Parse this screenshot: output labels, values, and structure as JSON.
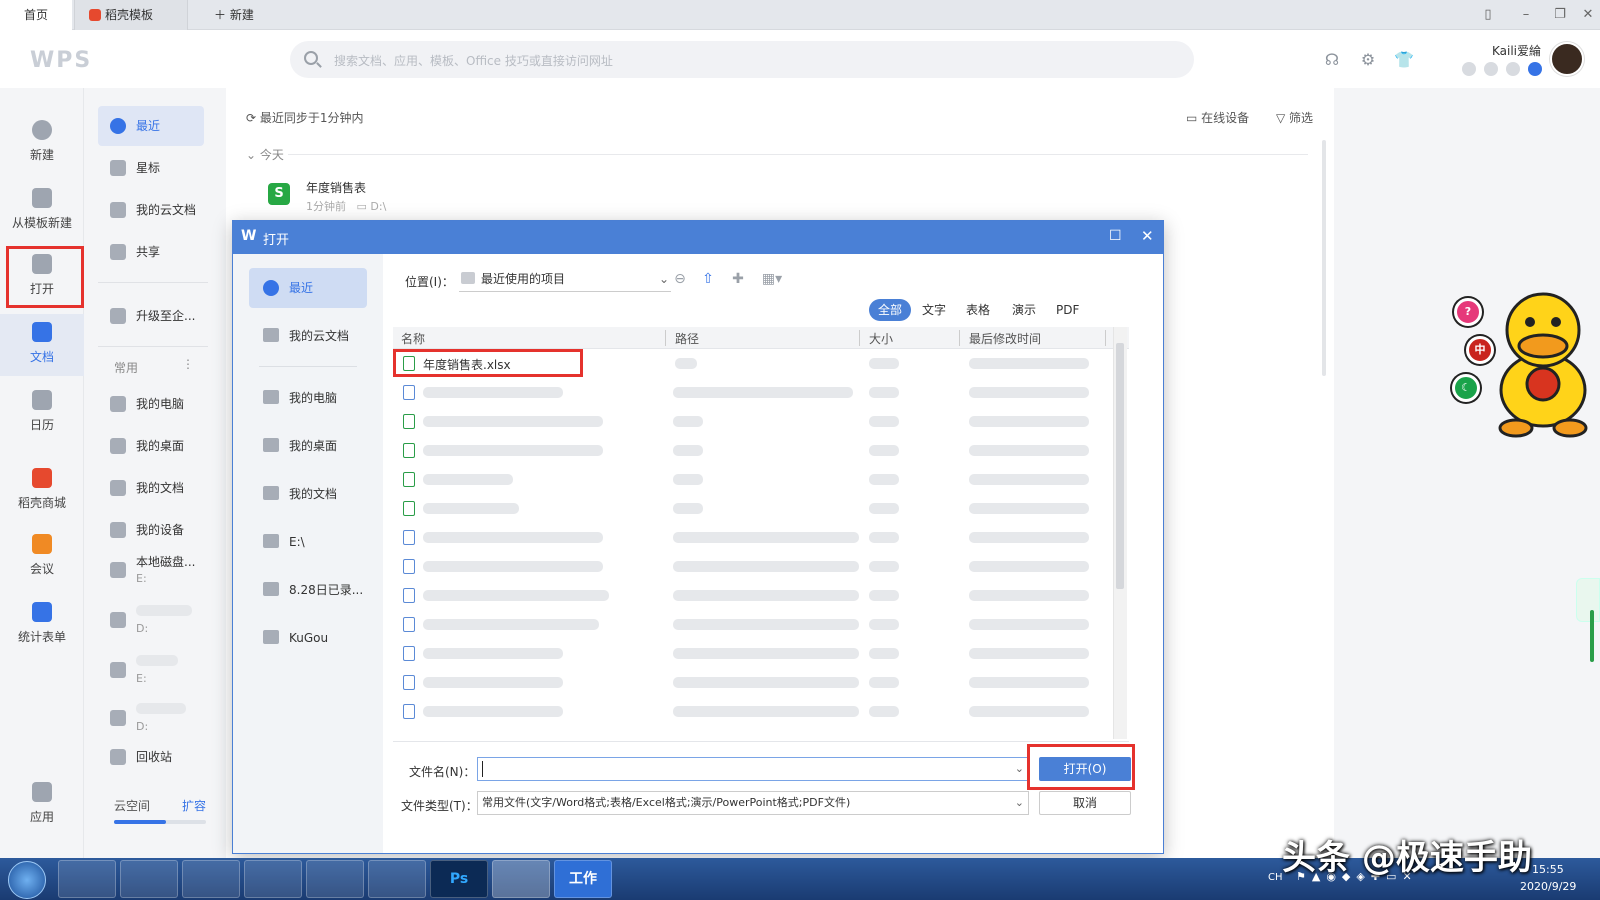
{
  "tabs": {
    "home": "首页",
    "templates": "稻壳模板",
    "new": "新建"
  },
  "header": {
    "logo": "WPS",
    "search_placeholder": "搜索文档、应用、模板、Office 技巧或直接访问网址",
    "user_name": "Kaili爱綸"
  },
  "rail": {
    "new": "新建",
    "from_template": "从模板新建",
    "open": "打开",
    "docs": "文档",
    "calendar": "日历",
    "store": "稻壳商城",
    "meeting": "会议",
    "forms": "统计表单",
    "apps": "应用"
  },
  "nav": {
    "recent": "最近",
    "starred": "星标",
    "cloud_docs": "我的云文档",
    "shared": "共享",
    "upgrade": "升级至企...",
    "common": "常用",
    "my_computer": "我的电脑",
    "my_desktop": "我的桌面",
    "my_docs": "我的文档",
    "my_devices": "我的设备",
    "local_disk": "本地磁盘...",
    "local_disk_sub": "E:",
    "item_d_sub": "D:",
    "item_e_sub": "E:",
    "item_d2_sub": "D:",
    "recycle": "回收站",
    "cloud_space": "云空间",
    "expand": "扩容"
  },
  "main": {
    "sync": "最近同步于1分钟内",
    "online_devices": "在线设备",
    "filter": "筛选",
    "today": "今天",
    "recent_file_name": "年度销售表",
    "recent_file_time": "1分钟前",
    "recent_file_path": "D:\\"
  },
  "dialog": {
    "title": "打开",
    "side": {
      "recent": "最近",
      "cloud_docs": "我的云文档",
      "my_computer": "我的电脑",
      "my_desktop": "我的桌面",
      "my_docs": "我的文档",
      "drive_e": "E:\\",
      "folder_828": "8.28日已录...",
      "kugou": "KuGou"
    },
    "location_label": "位置(I)：",
    "location_value": "最近使用的项目",
    "filters": [
      "全部",
      "文字",
      "表格",
      "演示",
      "PDF"
    ],
    "columns": {
      "name": "名称",
      "path": "路径",
      "size": "大小",
      "modified": "最后修改时间"
    },
    "first_file": "年度销售表.xlsx",
    "filename_label": "文件名(N)：",
    "filename_value": "",
    "filetype_label": "文件类型(T)：",
    "filetype_value": "常用文件(文字/Word格式;表格/Excel格式;演示/PowerPoint格式;PDF文件)",
    "open_button": "打开(O)",
    "cancel_button": "取消"
  },
  "taskbar": {
    "work": "工作",
    "ps": "Ps",
    "lang": "CH",
    "time": "15:55",
    "date": "2020/9/29"
  },
  "watermark": "头条 @极速手助",
  "colors": {
    "accent": "#4a80d6",
    "highlight": "#e5322d",
    "excel": "#27a844"
  }
}
